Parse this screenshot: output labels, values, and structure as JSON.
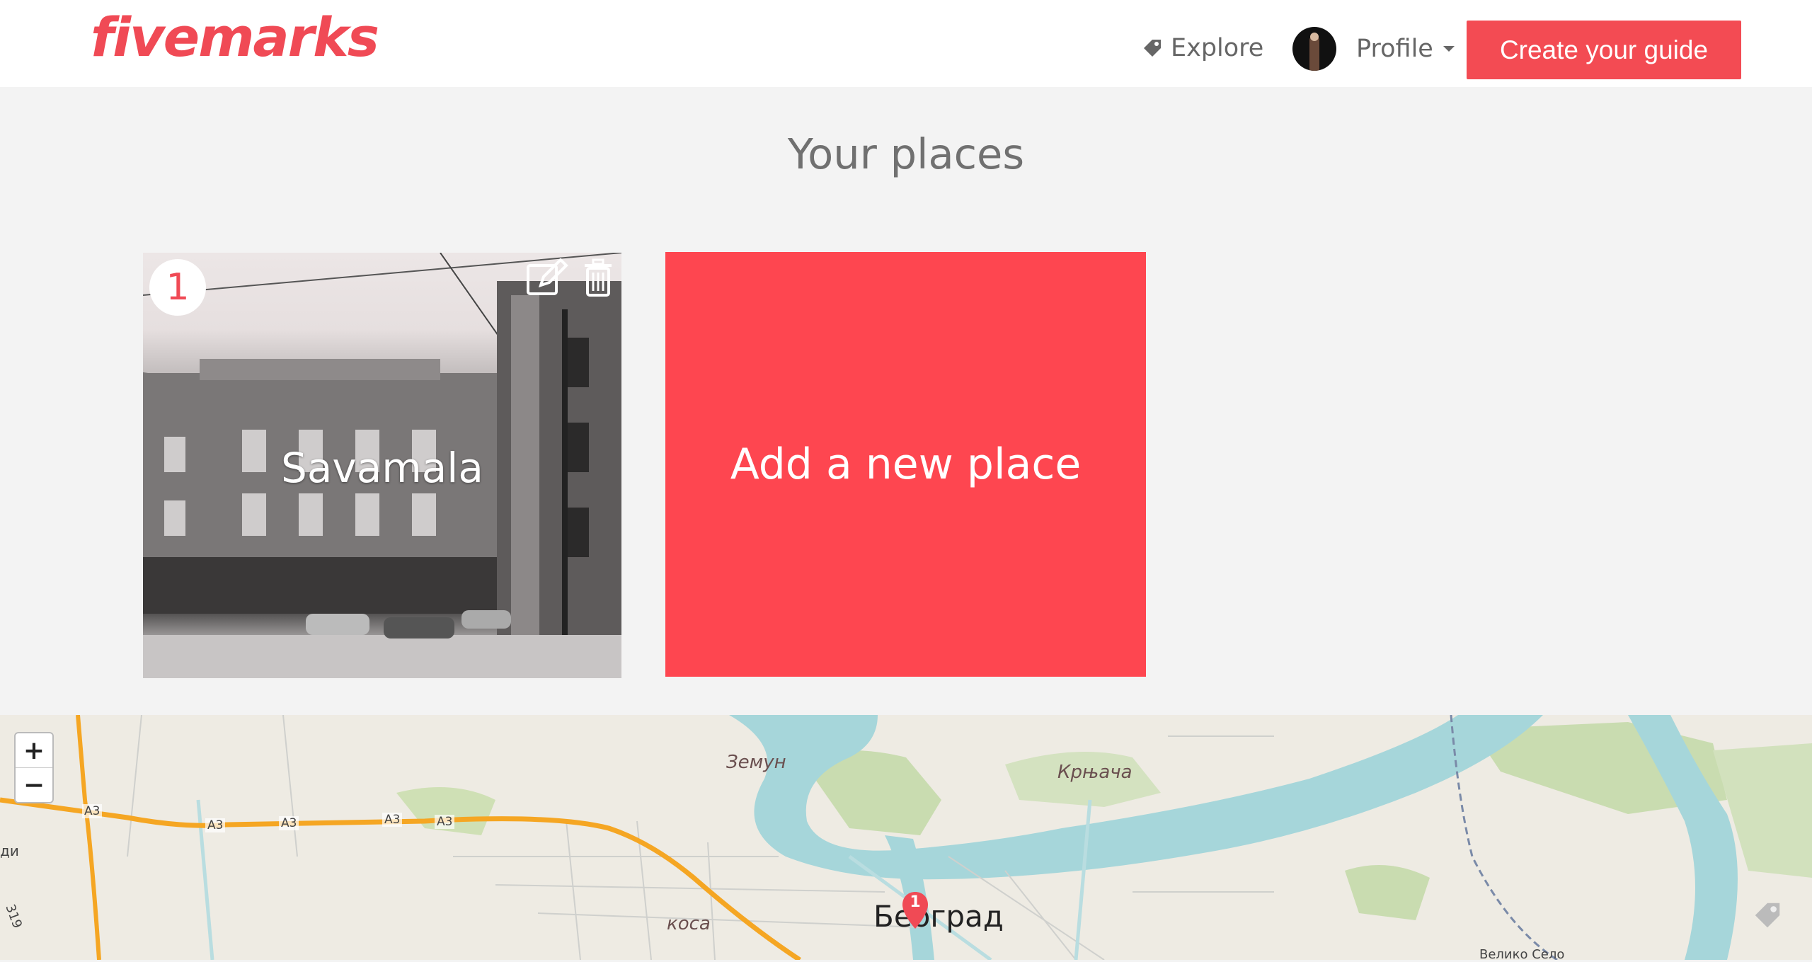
{
  "header": {
    "logo": "fivemarks",
    "nav_explore": "Explore",
    "profile_label": "Profile",
    "create_button": "Create your guide"
  },
  "main": {
    "title": "Your places",
    "places": [
      {
        "number": "1",
        "name": "Savamala"
      }
    ],
    "add_place_label": "Add a new place"
  },
  "map": {
    "zoom_in": "+",
    "zoom_out": "−",
    "labels": {
      "zemun": "Земун",
      "krnjaca": "Крњача",
      "beograd": "Београд",
      "kosa": "коса",
      "veliko_selo": "Велико Село",
      "left_edge": "ди",
      "road_319": "319"
    },
    "road_labels": [
      "A3",
      "A3",
      "A3",
      "A3",
      "A3"
    ],
    "marker_number": "1"
  },
  "colors": {
    "brand": "#f04a55",
    "button": "#f34b53",
    "add_card": "#fe4650",
    "river": "#a6d6da"
  }
}
